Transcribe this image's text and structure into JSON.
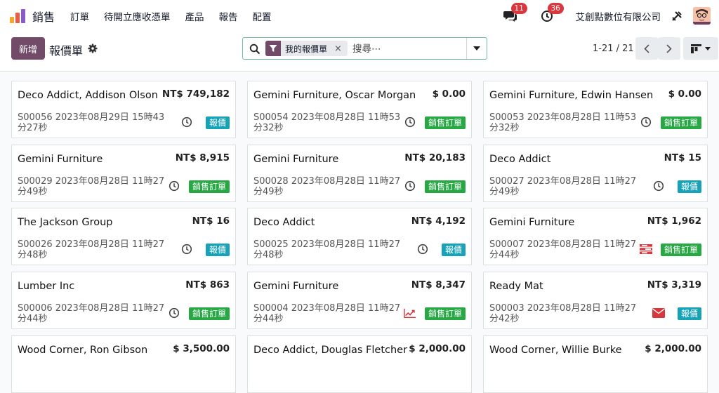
{
  "navbar": {
    "app_name": "銷售",
    "menu": [
      "訂單",
      "待開立應收憑單",
      "產品",
      "報告",
      "配置"
    ],
    "messages_count": "11",
    "activities_count": "36",
    "company": "艾創點數位有限公司"
  },
  "control": {
    "new_label": "新增",
    "title": "報價單",
    "facet_label": "我的報價單",
    "facet_remove": "×",
    "search_placeholder": "搜尋⋯",
    "pager": "1-21 / 21"
  },
  "colors": {
    "brand": "#714b67",
    "status_quotation": "#17a2b8",
    "status_sales_order": "#28a745",
    "badge": "#d9363e"
  },
  "cards": [
    {
      "customer": "Deco Addict, Addison Olson",
      "amount": "NT$ 749,182",
      "ref": "S00056 2023年08月29日 15時43分27秒",
      "status": "報價",
      "status_type": "quotation",
      "activity_icon": "clock-icon"
    },
    {
      "customer": "Gemini Furniture, Oscar Morgan",
      "amount": "$ 0.00",
      "ref": "S00054 2023年08月28日 11時53分32秒",
      "status": "銷售訂單",
      "status_type": "sales_order",
      "activity_icon": "clock-icon"
    },
    {
      "customer": "Gemini Furniture, Edwin Hansen",
      "amount": "$ 0.00",
      "ref": "S00053 2023年08月28日 11時53分32秒",
      "status": "銷售訂單",
      "status_type": "sales_order",
      "activity_icon": "clock-icon"
    },
    {
      "customer": "Gemini Furniture",
      "amount": "NT$ 8,915",
      "ref": "S00029 2023年08月28日 11時27分49秒",
      "status": "銷售訂單",
      "status_type": "sales_order",
      "activity_icon": "clock-icon"
    },
    {
      "customer": "Gemini Furniture",
      "amount": "NT$ 20,183",
      "ref": "S00028 2023年08月28日 11時27分49秒",
      "status": "銷售訂單",
      "status_type": "sales_order",
      "activity_icon": "clock-icon"
    },
    {
      "customer": "Deco Addict",
      "amount": "NT$ 15",
      "ref": "S00027 2023年08月28日 11時27分49秒",
      "status": "報價",
      "status_type": "quotation",
      "activity_icon": "clock-icon"
    },
    {
      "customer": "The Jackson Group",
      "amount": "NT$ 16",
      "ref": "S00026 2023年08月28日 11時27分48秒",
      "status": "報價",
      "status_type": "quotation",
      "activity_icon": "clock-icon"
    },
    {
      "customer": "Deco Addict",
      "amount": "NT$ 4,192",
      "ref": "S00025 2023年08月28日 11時27分48秒",
      "status": "報價",
      "status_type": "quotation",
      "activity_icon": "clock-icon"
    },
    {
      "customer": "Gemini Furniture",
      "amount": "NT$ 1,962",
      "ref": "S00007 2023年08月28日 11時27分44秒",
      "status": "銷售訂單",
      "status_type": "sales_order",
      "activity_icon": "tasks-icon"
    },
    {
      "customer": "Lumber Inc",
      "amount": "NT$ 863",
      "ref": "S00006 2023年08月28日 11時27分44秒",
      "status": "銷售訂單",
      "status_type": "sales_order",
      "activity_icon": "clock-icon"
    },
    {
      "customer": "Gemini Furniture",
      "amount": "NT$ 8,347",
      "ref": "S00004 2023年08月28日 11時27分44秒",
      "status": "銷售訂單",
      "status_type": "sales_order",
      "activity_icon": "chart-icon"
    },
    {
      "customer": "Ready Mat",
      "amount": "NT$ 3,319",
      "ref": "S00003 2023年08月28日 11時27分42秒",
      "status": "報價",
      "status_type": "quotation",
      "activity_icon": "envelope-icon"
    },
    {
      "customer": "Wood Corner, Ron Gibson",
      "amount": "$ 3,500.00"
    },
    {
      "customer": "Deco Addict, Douglas Fletcher",
      "amount": "$ 2,000.00"
    },
    {
      "customer": "Wood Corner, Willie Burke",
      "amount": "$ 2,000.00"
    }
  ]
}
